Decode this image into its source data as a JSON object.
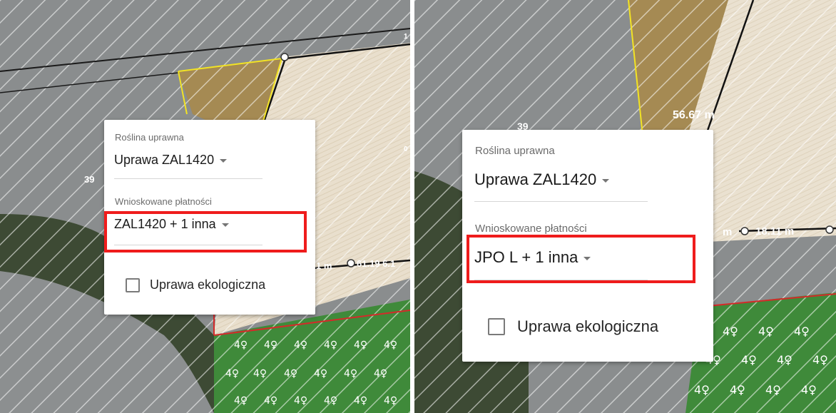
{
  "colors": {
    "highlight": "#ef1c1c",
    "parcel_outline": "#f2e324",
    "cadastral_line": "#111111",
    "crop_boundary": "#d42a2a"
  },
  "left_panel": {
    "map": {
      "parcel_number": "39",
      "parcel_number_2": "39",
      "edge_label": "0",
      "edge_label_2": "1",
      "distance_label_partial": "1 m",
      "distance_label_partial_2": "61.19 6.1",
      "forest_symbol": "⅌"
    },
    "popup": {
      "crop_label": "Roślina uprawna",
      "crop_value": "Uprawa ZAL1420",
      "payments_label": "Wnioskowane płatności",
      "payments_value": "ZAL1420 + 1 inna",
      "organic_label": "Uprawa ekologiczna",
      "organic_checked": false
    }
  },
  "right_panel": {
    "map": {
      "parcel_number": "39",
      "distance_label": "56.67 m",
      "distance_label_2": "18.11 m",
      "distance_label_partial": "m"
    },
    "popup": {
      "crop_label": "Roślina uprawna",
      "crop_value": "Uprawa ZAL1420",
      "payments_label": "Wnioskowane płatności",
      "payments_value": "JPO L + 1 inna",
      "organic_label": "Uprawa ekologiczna",
      "organic_checked": false
    }
  }
}
